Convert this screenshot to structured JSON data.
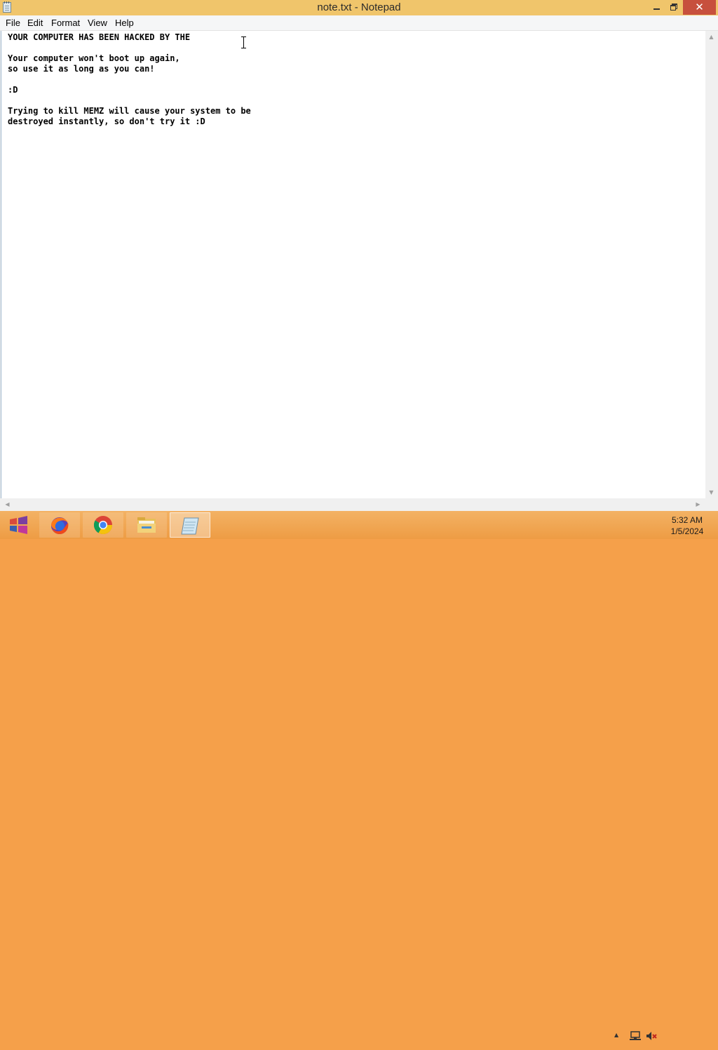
{
  "window": {
    "title": "note.txt - Notepad",
    "close_glyph": "✕"
  },
  "menu": {
    "items": [
      "File",
      "Edit",
      "Format",
      "View",
      "Help"
    ]
  },
  "editor": {
    "content": "YOUR COMPUTER HAS BEEN HACKED BY THE\n\nYour computer won't boot up again,\nso use it as long as you can!\n\n:D\n\nTrying to kill MEMZ will cause your system to be\ndestroyed instantly, so don't try it :D"
  },
  "scrollbars": {
    "up_arrow": "▲",
    "down_arrow": "▼",
    "left_arrow": "◀",
    "right_arrow": "▶"
  },
  "taskbar": {
    "pinned": [
      {
        "name": "Start",
        "icon": "windows-logo-icon"
      },
      {
        "name": "Firefox",
        "icon": "firefox-icon"
      },
      {
        "name": "Chrome",
        "icon": "chrome-icon"
      },
      {
        "name": "File Explorer",
        "icon": "folder-icon"
      },
      {
        "name": "Notepad",
        "icon": "notepad-icon"
      }
    ],
    "tray_arrow": "▲",
    "clock": {
      "time": "5:32 AM",
      "date": "1/5/2024"
    }
  },
  "colors": {
    "titlebar": "#f0c56b",
    "close_button": "#c7503d",
    "taskbar": "#f0a04b",
    "editor_background": "#ffffff"
  }
}
